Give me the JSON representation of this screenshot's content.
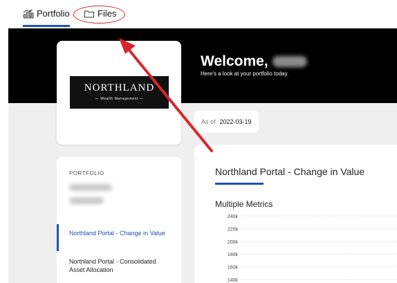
{
  "tabs": [
    {
      "label": "Portfolio",
      "icon": "chart-grid-icon",
      "active": true
    },
    {
      "label": "Files",
      "icon": "folder-icon",
      "active": false
    }
  ],
  "hero": {
    "welcome": "Welcome,",
    "subtitle": "Here's a look at your portfolio today."
  },
  "logo": {
    "main": "NORTHLAND",
    "sub": "— Wealth Management —"
  },
  "as_of": {
    "label": "As of",
    "date": "2022-03-19"
  },
  "sidebar": {
    "heading": "PORTFOLIO",
    "items": [
      {
        "label": "Northland Portal - Change in Value",
        "active": true
      },
      {
        "label": "Northland Portal - Consolidated Asset Allocation",
        "active": false
      }
    ]
  },
  "main": {
    "title": "Northland Portal - Change in Value",
    "chart_title": "Multiple Metrics"
  },
  "chart_data": {
    "type": "line",
    "yticks": [
      "240k",
      "220k",
      "200k",
      "180k",
      "160k",
      "140k"
    ],
    "grid": true
  },
  "colors": {
    "accent": "#1f4fb8",
    "annotation": "#d9262d",
    "hero_bg": "#000000",
    "page_bg": "#efefef"
  }
}
